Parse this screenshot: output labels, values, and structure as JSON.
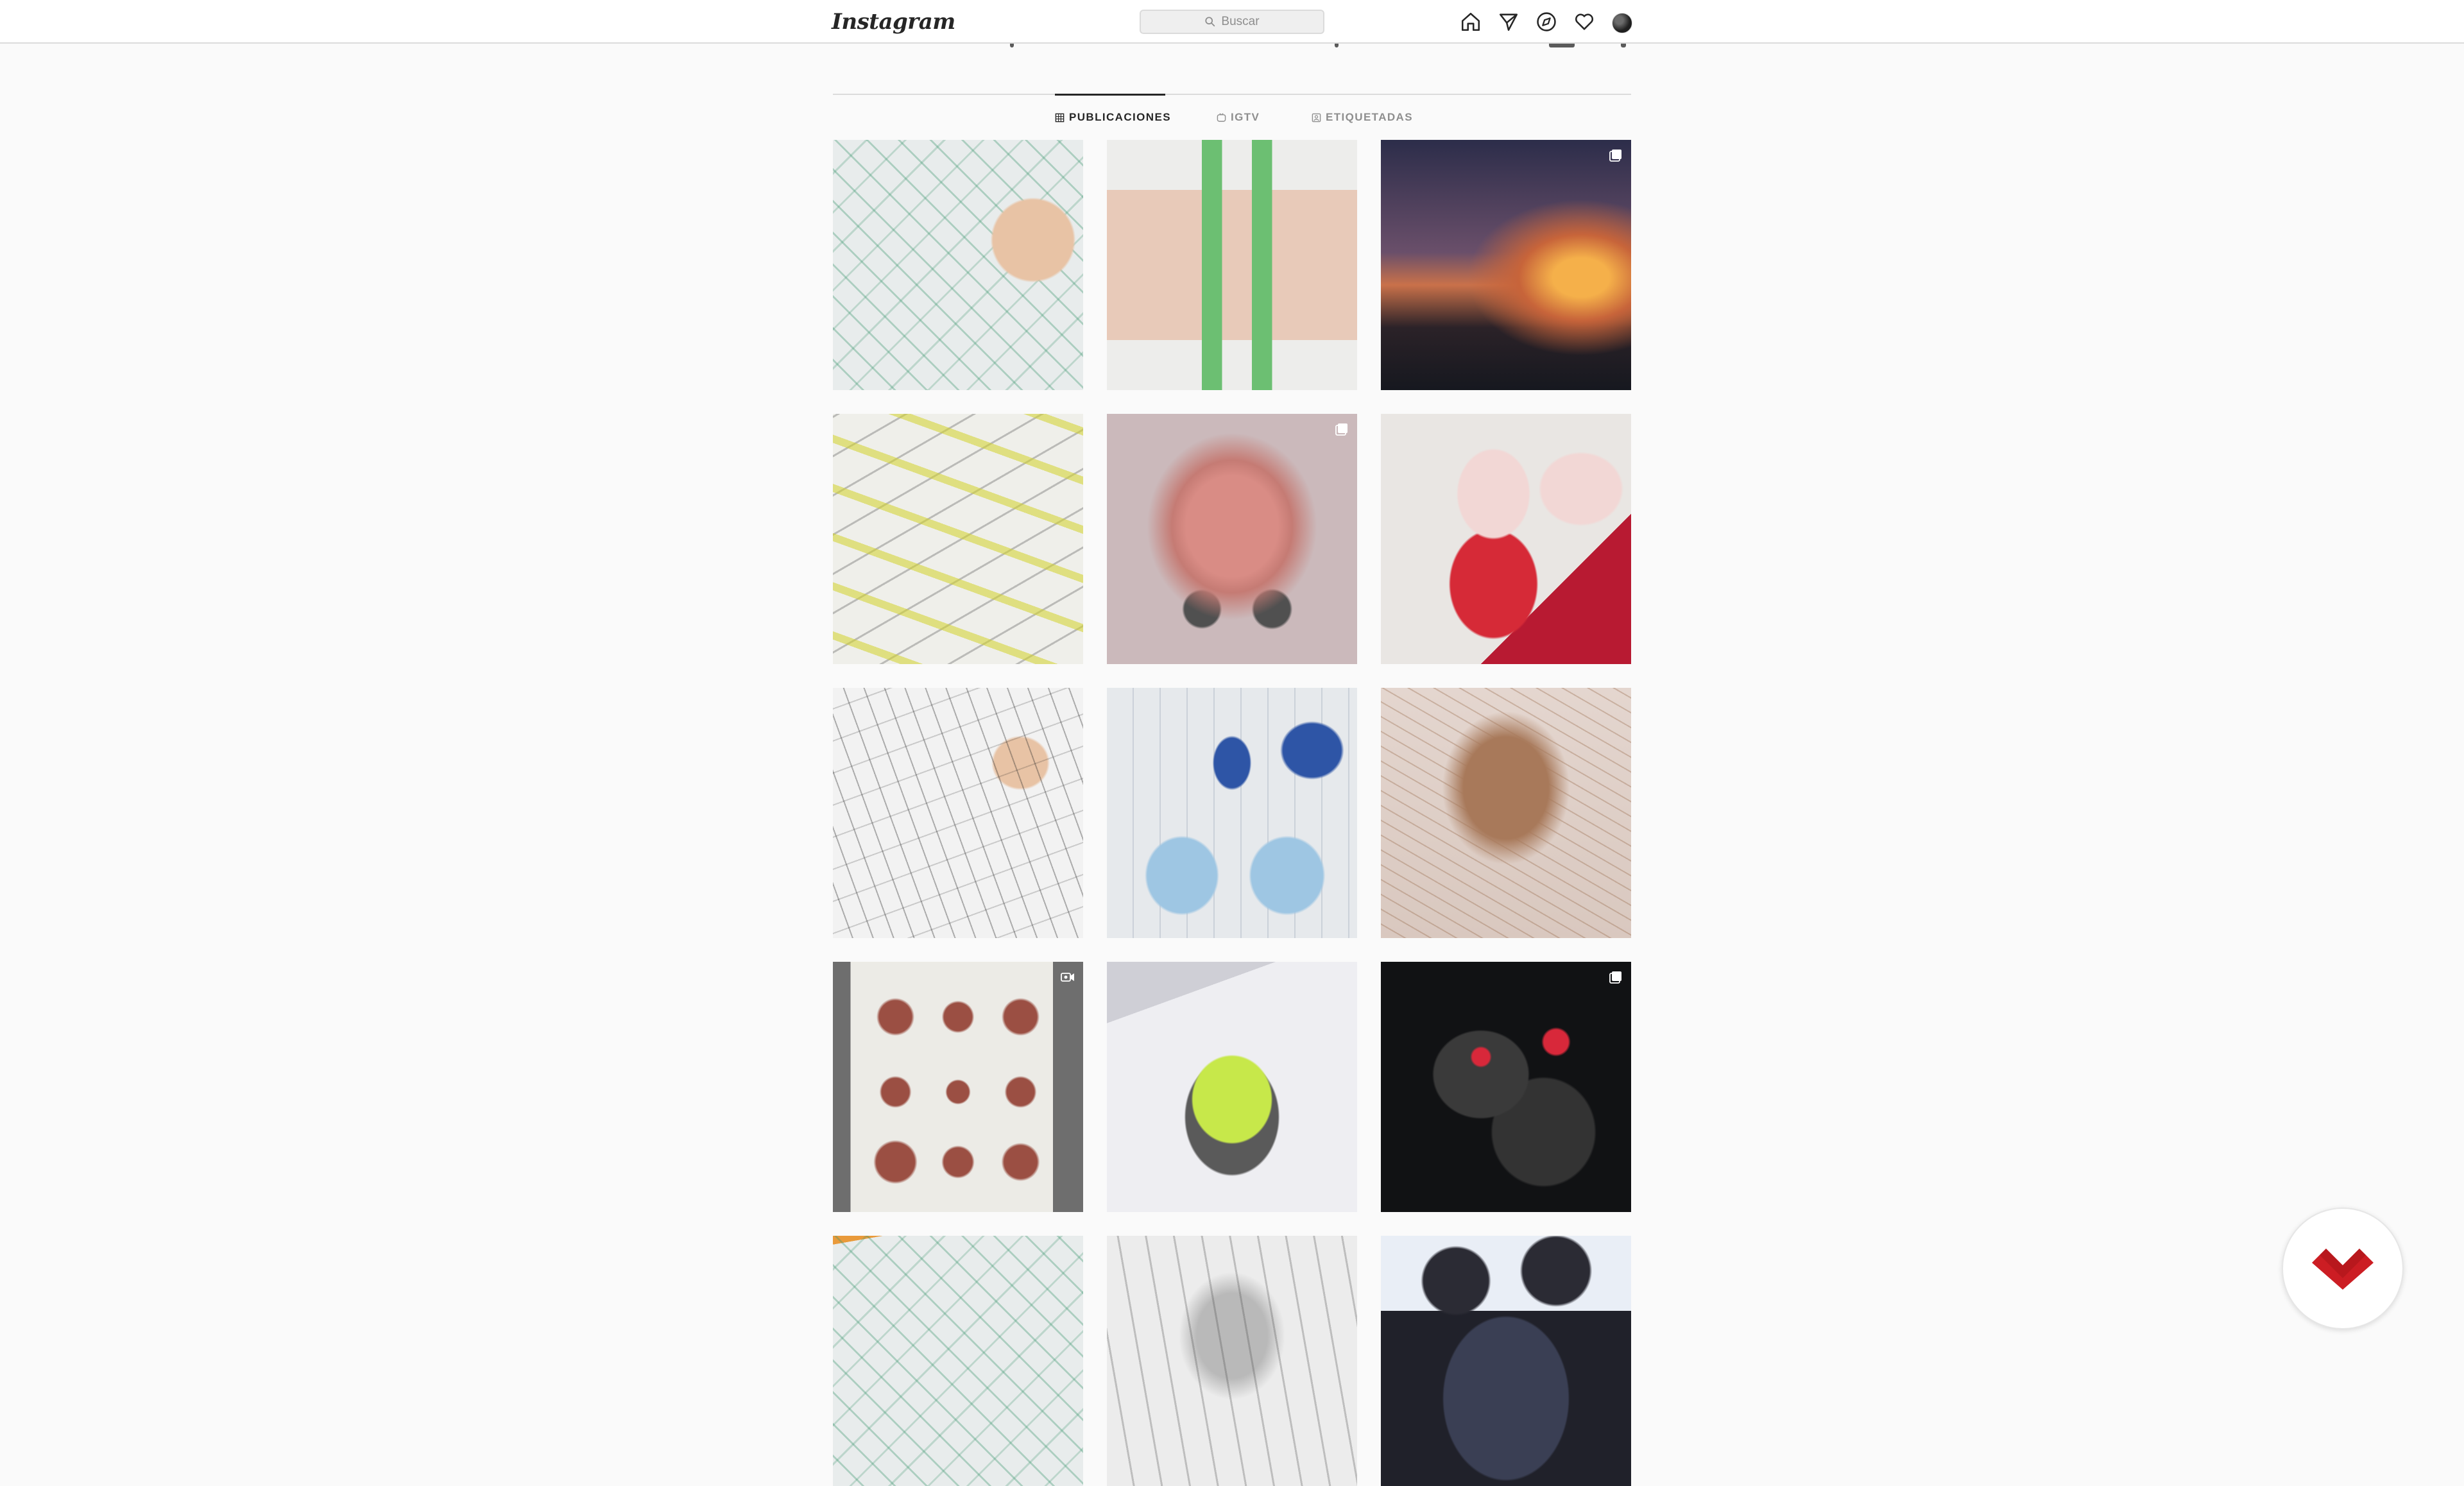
{
  "header": {
    "logo_text": "Instagram",
    "search_placeholder": "Buscar",
    "nav_icons": [
      "home-icon",
      "direct-icon",
      "explore-icon",
      "activity-icon",
      "profile-avatar"
    ]
  },
  "tabs": [
    {
      "label": "PUBLICACIONES",
      "icon": "grid-icon",
      "active": true
    },
    {
      "label": "IGTV",
      "icon": "igtv-icon",
      "active": false
    },
    {
      "label": "ETIQUETADAS",
      "icon": "tagged-icon",
      "active": false
    }
  ],
  "posts": [
    {
      "subject": "green product sketch with hand drawing",
      "badge": null
    },
    {
      "subject": "green letter sketch with markers",
      "badge": null
    },
    {
      "subject": "sunset meditation photo",
      "badge": "carousel-icon"
    },
    {
      "subject": "yellow furniture sketches",
      "badge": null
    },
    {
      "subject": "pink robot vehicle render",
      "badge": "carousel-icon"
    },
    {
      "subject": "pink and red stool sketches",
      "badge": null
    },
    {
      "subject": "backpack line sketch with hand",
      "badge": null
    },
    {
      "subject": "blue bottle sketches",
      "badge": null
    },
    {
      "subject": "brown backpack sketch",
      "badge": null
    },
    {
      "subject": "backpack sheet with marker pens",
      "badge": "video-icon"
    },
    {
      "subject": "lime green device sketch",
      "badge": null
    },
    {
      "subject": "black drone render",
      "badge": "carousel-icon"
    },
    {
      "subject": "green product sketch with pencil",
      "badge": null
    },
    {
      "subject": "grey object sketch",
      "badge": null
    },
    {
      "subject": "people outdoors photo",
      "badge": null
    }
  ],
  "colors": {
    "background": "#fafafa",
    "text": "#262626",
    "muted": "#8e8e8e",
    "border": "#dbdbdb",
    "widget_red": "#cc1d23"
  }
}
